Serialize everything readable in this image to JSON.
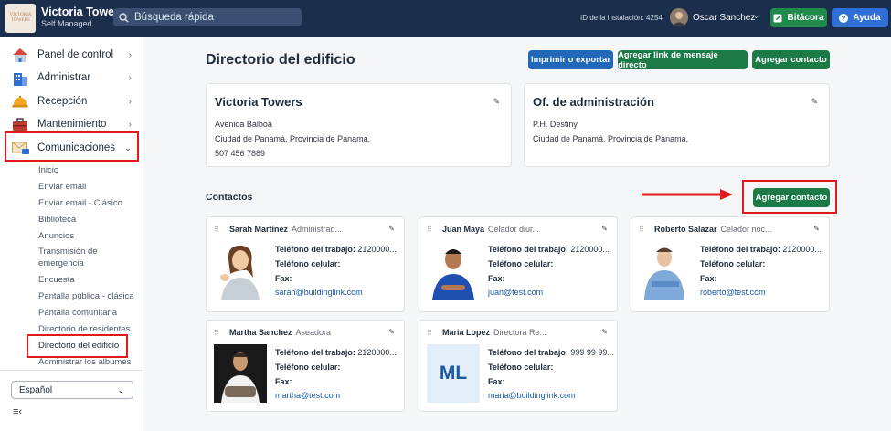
{
  "app": {
    "title": "Victoria Towers",
    "subtitle": "Self Managed",
    "logo_text": "VICTORIA TOWERS"
  },
  "search": {
    "placeholder": "Búsqueda rápida"
  },
  "header": {
    "installation_id": "ID de la instalación: 4254",
    "user": "Oscar Sanchez",
    "bitacora": "Bitácora",
    "ayuda": "Ayuda"
  },
  "sidebar": {
    "items": [
      {
        "label": "Panel de control"
      },
      {
        "label": "Administrar"
      },
      {
        "label": "Recepción"
      },
      {
        "label": "Mantenimiento"
      },
      {
        "label": "Comunicaciones"
      }
    ],
    "subitems": [
      "Inicio",
      "Enviar email",
      "Enviar email - Clásico",
      "Biblioteca",
      "Anuncios",
      "Transmisión de",
      "emergencia",
      "Encuesta",
      "Pantalla pública - clásica",
      "Pantalla comunitaria",
      "Directorio de residentes",
      "Directorio del edificio",
      "Administrar los álbumes"
    ],
    "language": "Español"
  },
  "page": {
    "title": "Directorio del edificio",
    "btn_print": "Imprimir o exportar",
    "btn_link": "Agregar link de mensaje directo",
    "btn_add": "Agregar contacto",
    "contacts_title": "Contactos",
    "btn_add2": "Agregar contacto"
  },
  "building": {
    "name": "Victoria Towers",
    "lines": [
      "Avenida Balboa",
      "Ciudad de Panamá, Provincia de Panama,",
      "507 456 7889"
    ]
  },
  "office": {
    "name": "Of. de administración",
    "lines": [
      "P.H. Destiny",
      "Ciudad de Panamá, Provincia de Panama,"
    ]
  },
  "labels": {
    "work": "Teléfono del trabajo:",
    "cell": "Teléfono celular:",
    "fax": "Fax:"
  },
  "contacts": [
    {
      "name": "Sarah Martínez",
      "role": "Administrad...",
      "work": " 2120000...",
      "email": "sarah@buildinglink.com"
    },
    {
      "name": "Juan Maya",
      "role": "Celador diur...",
      "work": " 2120000...",
      "email": "juan@test.com"
    },
    {
      "name": "Roberto Salazar",
      "role": "Celador noc...",
      "work": " 2120000...",
      "email": "roberto@test.com"
    },
    {
      "name": "Martha Sanchez",
      "role": "Aseadora",
      "work": " 2120000...",
      "email": "martha@test.com"
    },
    {
      "name": "Maria Lopez",
      "role": "Directora Re...",
      "work": " 999 99 99...",
      "email": "maria@buildinglink.com",
      "initials": "ML"
    }
  ],
  "colors": {
    "topbar": "#1b2f4d",
    "green": "#1b7a45",
    "blue": "#2169b8",
    "highlight": "#e01b1b"
  }
}
